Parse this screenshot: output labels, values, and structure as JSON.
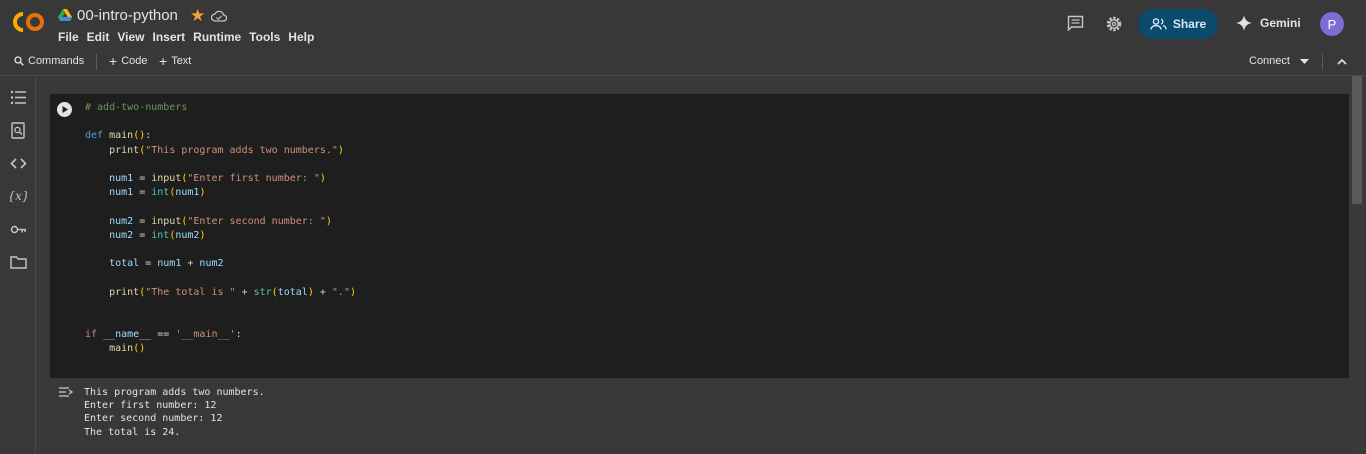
{
  "app": {
    "notebook_title": "00-intro-python",
    "menu": [
      "File",
      "Edit",
      "View",
      "Insert",
      "Runtime",
      "Tools",
      "Help"
    ],
    "share_label": "Share",
    "gemini_label": "Gemini",
    "avatar_letter": "P"
  },
  "toolbar": {
    "commands_label": "Commands",
    "code_label": "Code",
    "text_label": "Text",
    "connect_label": "Connect"
  },
  "cell": {
    "code_lines": [
      "# add-two-numbers",
      "",
      "def main():",
      "    print(\"This program adds two numbers.\")",
      "",
      "    num1 = input(\"Enter first number: \")",
      "    num1 = int(num1)",
      "",
      "    num2 = input(\"Enter second number: \")",
      "    num2 = int(num2)",
      "",
      "    total = num1 + num2",
      "",
      "    print(\"The total is \" + str(total) + \".\")",
      "",
      "",
      "if __name__ == '__main__':",
      "    main()"
    ],
    "output_lines": [
      "This program adds two numbers.",
      "Enter first number: 12",
      "Enter second number: 12",
      "The total is 24."
    ]
  },
  "colors": {
    "accent_orange": "#f7a230",
    "share_bg": "#0b4a6b",
    "cell_bg": "#1e1e1e"
  }
}
